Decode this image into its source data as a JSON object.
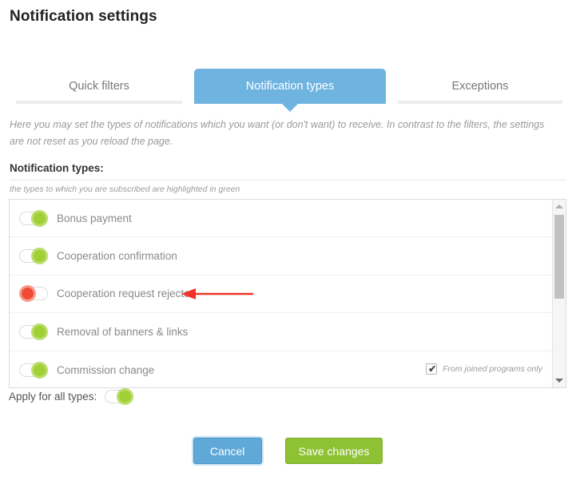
{
  "page": {
    "title": "Notification settings"
  },
  "tabs": [
    {
      "label": "Quick filters",
      "active": false
    },
    {
      "label": "Notification types",
      "active": true
    },
    {
      "label": "Exceptions",
      "active": false
    }
  ],
  "intro": "Here you may set the types of notifications which you want (or don't want) to receive. In contrast to the filters, the settings are not reset as you reload the page.",
  "section": {
    "heading": "Notification types:",
    "subtitle": "the types to which you are subscribed are highlighted in green"
  },
  "types": [
    {
      "label": "Bonus payment",
      "state": "on",
      "extra": null
    },
    {
      "label": "Cooperation confirmation",
      "state": "on",
      "extra": null
    },
    {
      "label": "Cooperation request rejected",
      "state": "off",
      "extra": null
    },
    {
      "label": "Removal of banners & links",
      "state": "on",
      "extra": null
    },
    {
      "label": "Commission change",
      "state": "on",
      "extra": {
        "checked": true,
        "label": "From joined programs only",
        "mark": "✔"
      }
    }
  ],
  "scrollbar": {
    "up_glyph": "▲",
    "down_glyph": "▼"
  },
  "apply_all": {
    "label": "Apply for all types:",
    "state": "on"
  },
  "buttons": {
    "cancel": "Cancel",
    "save": "Save changes"
  },
  "colors": {
    "tab_active": "#6fb3e0",
    "toggle_on": "#a0d036",
    "toggle_off": "#ef4b35",
    "save_button": "#8ec133",
    "cancel_button": "#5fa8d8",
    "annotation_arrow": "#f03228"
  }
}
